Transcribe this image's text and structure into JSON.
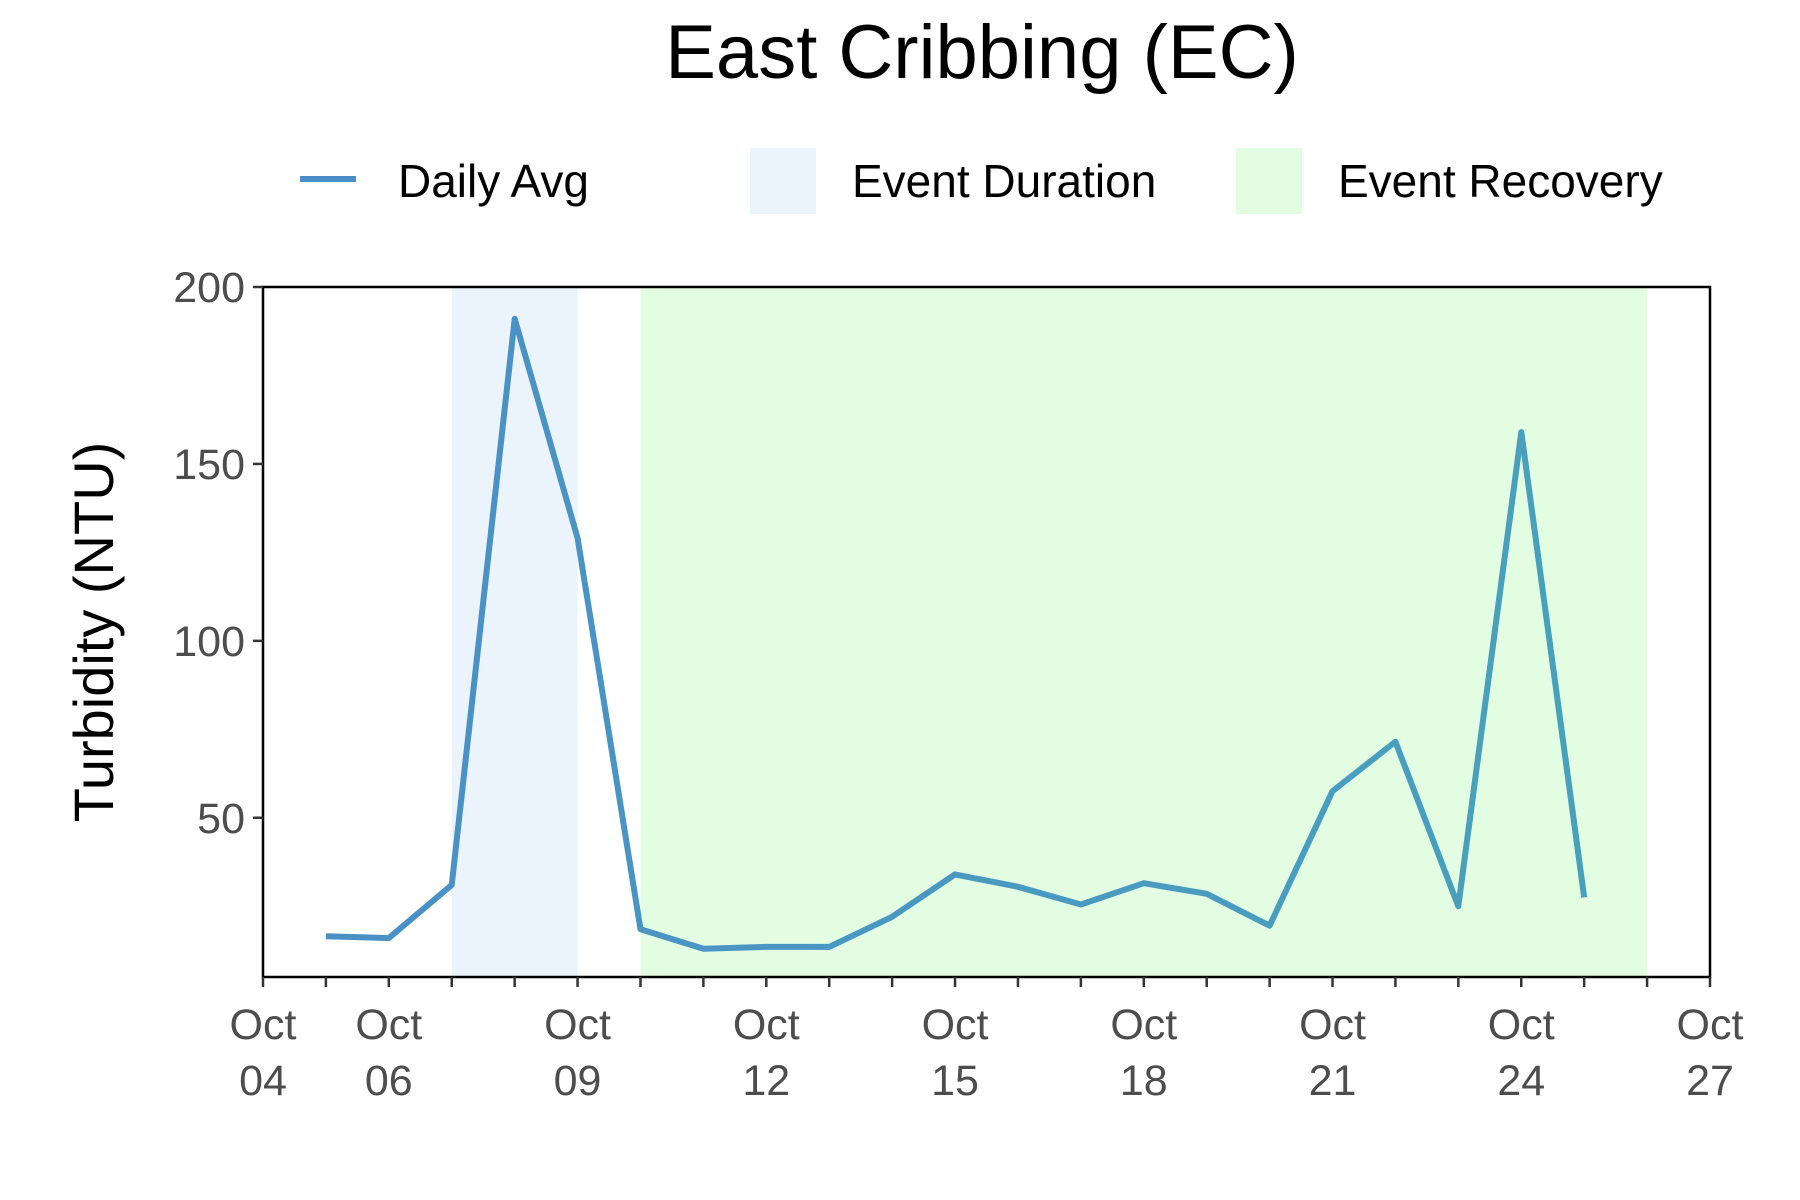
{
  "chart_data": {
    "type": "line",
    "title": "East Cribbing (EC)",
    "xlabel": "",
    "ylabel": "Turbidity (NTU)",
    "ylim": [
      5,
      200
    ],
    "y_ticks": [
      50,
      100,
      150,
      200
    ],
    "xlim": [
      "2023-10-04",
      "2023-10-27"
    ],
    "x_ticks": [
      {
        "date": "2023-10-04",
        "label_top": "Oct",
        "label_bottom": "04"
      },
      {
        "date": "2023-10-06",
        "label_top": "Oct",
        "label_bottom": "06"
      },
      {
        "date": "2023-10-09",
        "label_top": "Oct",
        "label_bottom": "09"
      },
      {
        "date": "2023-10-12",
        "label_top": "Oct",
        "label_bottom": "12"
      },
      {
        "date": "2023-10-15",
        "label_top": "Oct",
        "label_bottom": "15"
      },
      {
        "date": "2023-10-18",
        "label_top": "Oct",
        "label_bottom": "18"
      },
      {
        "date": "2023-10-21",
        "label_top": "Oct",
        "label_bottom": "21"
      },
      {
        "date": "2023-10-24",
        "label_top": "Oct",
        "label_bottom": "24"
      },
      {
        "date": "2023-10-27",
        "label_top": "Oct",
        "label_bottom": "27"
      }
    ],
    "grid": false,
    "legend_position": "top",
    "legend": [
      {
        "label": "Daily Avg",
        "kind": "line",
        "color": "#4a8fc8"
      },
      {
        "label": "Event Duration",
        "kind": "fill",
        "color": "#ebf3fc"
      },
      {
        "label": "Event Recovery",
        "kind": "fill",
        "color": "#e2fde2"
      }
    ],
    "shaded_regions": [
      {
        "name": "Event Duration",
        "start": "2023-10-07",
        "end": "2023-10-09",
        "color": "#ebf3fc"
      },
      {
        "name": "Event Recovery",
        "start": "2023-10-10",
        "end": "2023-10-26",
        "color": "#e2fde2"
      }
    ],
    "series": [
      {
        "name": "Daily Avg",
        "color_start": "#4a8fc8",
        "color_end": "#48a3ba",
        "x": [
          "2023-10-05",
          "2023-10-06",
          "2023-10-07",
          "2023-10-08",
          "2023-10-09",
          "2023-10-10",
          "2023-10-11",
          "2023-10-12",
          "2023-10-13",
          "2023-10-14",
          "2023-10-15",
          "2023-10-16",
          "2023-10-17",
          "2023-10-18",
          "2023-10-19",
          "2023-10-20",
          "2023-10-21",
          "2023-10-22",
          "2023-10-23",
          "2023-10-24",
          "2023-10-25"
        ],
        "y": [
          16.5,
          16,
          31,
          191,
          129,
          18.5,
          13,
          13.5,
          13.5,
          22,
          34,
          30.5,
          25.5,
          31.5,
          28.5,
          19.5,
          57.5,
          71.5,
          25,
          159,
          27.5
        ]
      }
    ]
  }
}
